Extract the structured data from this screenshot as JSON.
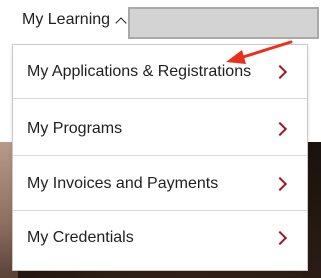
{
  "nav": {
    "my_learning_label": "My Learning"
  },
  "dropdown": {
    "items": [
      {
        "label": "My Applications & Registrations"
      },
      {
        "label": "My Programs"
      },
      {
        "label": "My Invoices and Payments"
      },
      {
        "label": "My Credentials"
      }
    ]
  },
  "colors": {
    "chevron": "#9b1b30",
    "annotation_arrow": "#e8301c"
  },
  "icons": [
    "caret-up-icon",
    "chevron-right-icon",
    "annotation-arrow-icon"
  ]
}
